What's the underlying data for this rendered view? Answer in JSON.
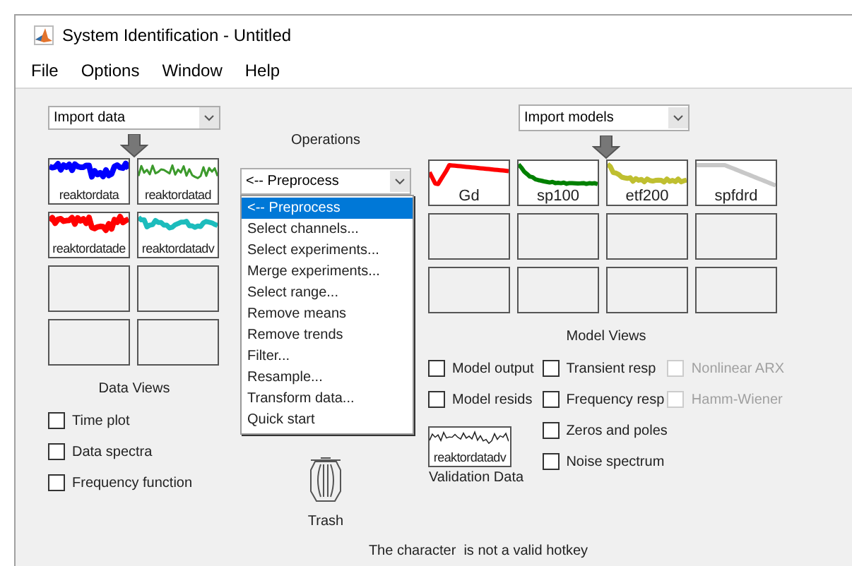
{
  "window": {
    "title": "System Identification - Untitled"
  },
  "menu": [
    "File",
    "Options",
    "Window",
    "Help"
  ],
  "data_panel": {
    "import_dropdown": "Import data",
    "tiles": [
      {
        "name": "reaktordata",
        "kind": "thick-noise",
        "color": "#0000ff"
      },
      {
        "name": "reaktordatad",
        "kind": "thin-noise",
        "color": "#3c9a2c"
      },
      {
        "name": "reaktordatade",
        "kind": "thick-noise",
        "color": "#ff0000"
      },
      {
        "name": "reaktordatadv",
        "kind": "thick-wave",
        "color": "#1cbcbc"
      },
      {
        "kind": "empty"
      },
      {
        "kind": "empty"
      },
      {
        "kind": "empty"
      },
      {
        "kind": "empty"
      }
    ],
    "views_label": "Data Views",
    "views": [
      {
        "label": "Time plot",
        "checked": false
      },
      {
        "label": "Data spectra",
        "checked": false
      },
      {
        "label": "Frequency function",
        "checked": false
      }
    ]
  },
  "operations": {
    "label": "Operations",
    "dropdown": "<-- Preprocess",
    "items": [
      {
        "label": "<-- Preprocess",
        "selected": true
      },
      {
        "label": "Select channels...",
        "selected": false
      },
      {
        "label": "Select experiments...",
        "selected": false
      },
      {
        "label": "Merge experiments...",
        "selected": false
      },
      {
        "label": "Select range...",
        "selected": false
      },
      {
        "label": "Remove means",
        "selected": false
      },
      {
        "label": "Remove trends",
        "selected": false
      },
      {
        "label": "Filter...",
        "selected": false
      },
      {
        "label": "Resample...",
        "selected": false
      },
      {
        "label": "Transform data...",
        "selected": false
      },
      {
        "label": "Quick start",
        "selected": false
      }
    ]
  },
  "trash": {
    "label": "Trash"
  },
  "models_panel": {
    "import_dropdown": "Import models",
    "tiles": [
      {
        "name": "Gd",
        "kind": "dip",
        "color": "#ff0000"
      },
      {
        "name": "sp100",
        "kind": "decay",
        "color": "#008000"
      },
      {
        "name": "etf200",
        "kind": "noisy-decay",
        "color": "#bfbf30"
      },
      {
        "name": "spfdrd",
        "kind": "fall",
        "color": "#c8c8c8"
      },
      {
        "kind": "empty"
      },
      {
        "kind": "empty"
      },
      {
        "kind": "empty"
      },
      {
        "kind": "empty"
      },
      {
        "kind": "empty"
      },
      {
        "kind": "empty"
      },
      {
        "kind": "empty"
      },
      {
        "kind": "empty"
      }
    ],
    "views_label": "Model Views",
    "views": [
      [
        {
          "label": "Model output",
          "checked": false,
          "disabled": false
        },
        {
          "label": "Model resids",
          "checked": false,
          "disabled": false
        }
      ],
      [
        {
          "label": "Transient resp",
          "checked": false,
          "disabled": false
        },
        {
          "label": "Frequency resp",
          "checked": false,
          "disabled": false
        },
        {
          "label": "Zeros and poles",
          "checked": false,
          "disabled": false
        },
        {
          "label": "Noise spectrum",
          "checked": false,
          "disabled": false
        }
      ],
      [
        {
          "label": "Nonlinear ARX",
          "checked": false,
          "disabled": true
        },
        {
          "label": "Hamm-Wiener",
          "checked": false,
          "disabled": true
        }
      ]
    ]
  },
  "validation": {
    "name": "reaktordatadv",
    "label": "Validation Data"
  },
  "status_bar": "The character  is not a valid hotkey"
}
